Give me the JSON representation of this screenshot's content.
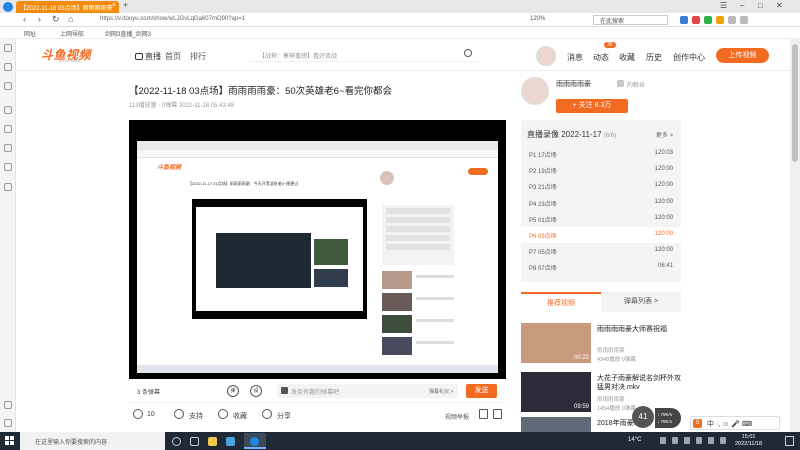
{
  "browser": {
    "tab_title": "【2022-11-18 03点场】雨雨雨雨豪",
    "new_tab": "+",
    "url": "https://v.douyu.com/show/wLJGvLqGa607mO90?ap=1",
    "zoom": "120%",
    "search_placeholder": "在此搜索",
    "bookmarks": [
      "网址",
      "上网导航",
      "剑网3直播_剑网3"
    ]
  },
  "site": {
    "logo": "斗鱼视频",
    "logo_sub": "DOUYU VIDEO",
    "nav": {
      "live": "直播",
      "home": "首页",
      "rank": "排行"
    },
    "search_placeholder": "【战神：寒神重磅】看好双战",
    "header_items": {
      "messages": "消息",
      "dynamics": "动态",
      "favorites": "收藏",
      "history": "历史",
      "creator": "创作中心"
    },
    "dynamics_badge": "36",
    "upload_label": "上传视频"
  },
  "video": {
    "title": "【2022-11-18 03点场】雨雨雨雨豪：50次英雄老6~看完你都会",
    "meta": "113播放量 · 0弹幕   2022-11-18 05:43:48"
  },
  "player_inner": {
    "logo": "斗鱼视频",
    "title": "【2022-11-17 21点场】雨雨雨雨豪：今天开黑混吃老6~随便过"
  },
  "danmaku": {
    "count": "3 条弹幕",
    "toggle1": "弹",
    "toggle2": "设",
    "placeholder": "发条有趣的弹幕吧",
    "etiquette": "弹幕礼仪 >",
    "send": "发送"
  },
  "actions": {
    "likes": "10",
    "support": "支持",
    "favorite": "收藏",
    "share": "分享",
    "report": "视频举报"
  },
  "uploader": {
    "name": "雨雨雨雨豪",
    "fans_label": "的粉丝",
    "follow": "+ 关注  8.3万"
  },
  "playlist": {
    "header": "直播录像 2022-11-17",
    "count": "(6/8)",
    "more": "更多 >",
    "items": [
      {
        "label": "P1 17点场",
        "duration": "120:03",
        "active": false
      },
      {
        "label": "P2 19点场",
        "duration": "120:00",
        "active": false
      },
      {
        "label": "P3 21点场",
        "duration": "120:00",
        "active": false
      },
      {
        "label": "P4 23点场",
        "duration": "120:00",
        "active": false
      },
      {
        "label": "P5 01点场",
        "duration": "120:00",
        "active": false
      },
      {
        "label": "P6 03点场",
        "duration": "120:00",
        "active": true
      },
      {
        "label": "P7 05点场",
        "duration": "120:00",
        "active": false
      },
      {
        "label": "P8 07点场",
        "duration": "06:41",
        "active": false
      }
    ]
  },
  "recommend": {
    "tab_active": "推荐视频",
    "tab_other": "弹幕列表 >",
    "items": [
      {
        "title": "雨雨雨雨豪大师赛祝福",
        "author": "雨雨雨雨豪",
        "stats": "4348播放   0弹幕",
        "duration": "00:22"
      },
      {
        "title": "大花子雨豪解说名剑杯外攻猛男对决.mkv",
        "author": "雨雨雨雨豪",
        "stats": "1454播放   0弹幕",
        "duration": "09:59"
      },
      {
        "title": "2018年雨豪...",
        "author": "",
        "stats": "",
        "duration": ""
      }
    ]
  },
  "float": {
    "score": "41",
    "stats_line1": "↑ 79K/s",
    "stats_line2": "↓ 79K/s"
  },
  "ime": {
    "logo": "S",
    "mode": "中 ·, ☺ 🎤 ⌨"
  },
  "taskbar": {
    "search_placeholder": "在这里输入你要搜索的内容",
    "temp": "14°C",
    "time": "15:01",
    "date": "2022/11/18"
  }
}
